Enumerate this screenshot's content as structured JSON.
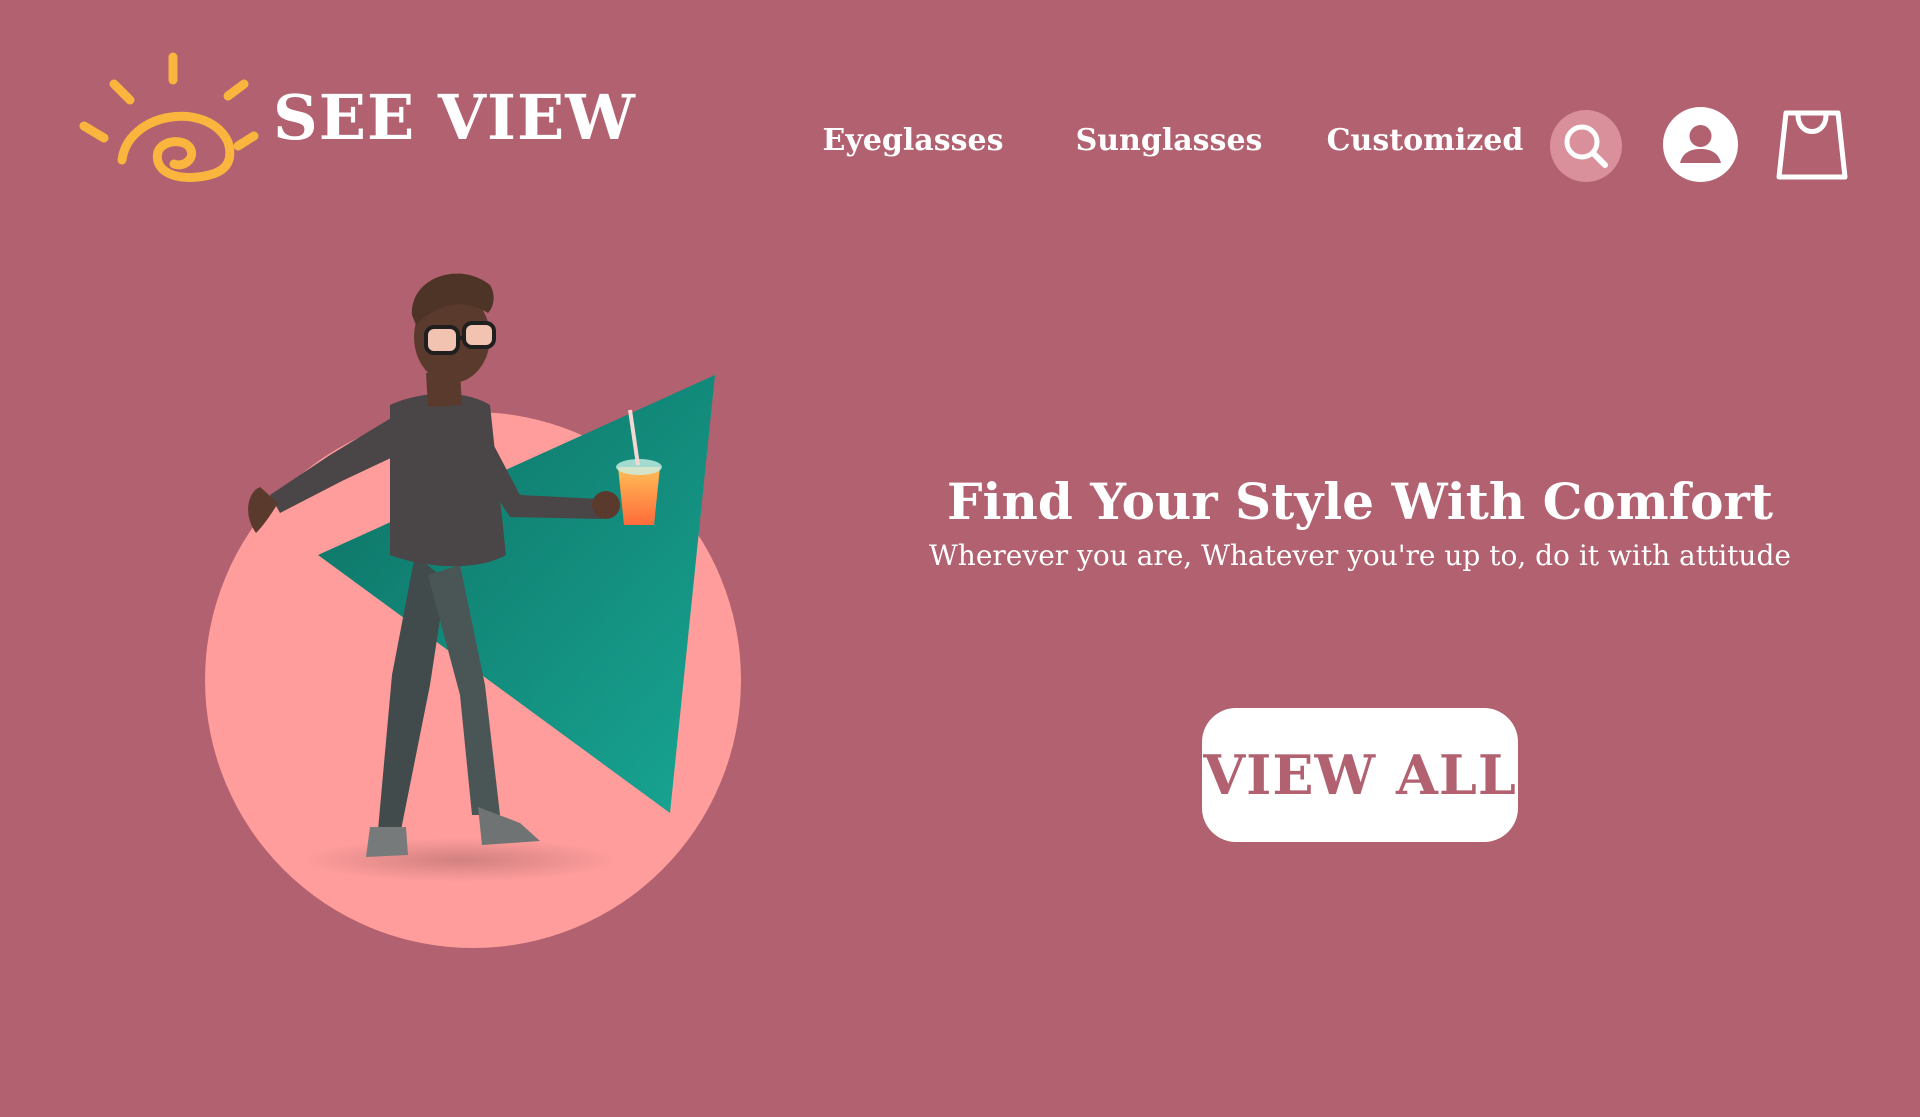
{
  "brand": {
    "name": "SEE VIEW",
    "logo_icon": "sun-eye-logo-icon",
    "logo_color": "#f9b53d"
  },
  "nav": {
    "items": [
      {
        "label": "Eyeglasses"
      },
      {
        "label": "Sunglasses"
      },
      {
        "label": "Customized"
      }
    ]
  },
  "header_icons": {
    "search": "search-icon",
    "account": "user-icon",
    "cart": "shopping-bag-icon"
  },
  "hero": {
    "title": "Find Your Style With Comfort",
    "subtitle": "Wherever you are, Whatever you're up to, do it with attitude",
    "cta_label": "VIEW ALL",
    "illustration": "man-with-glasses-and-drink-illustration"
  },
  "colors": {
    "background": "#b1616f",
    "circle": "#ff9d9c",
    "triangle": "#14a08c",
    "search_circle": "#d9909b",
    "text": "#ffffff",
    "cta_text": "#b1616f"
  }
}
